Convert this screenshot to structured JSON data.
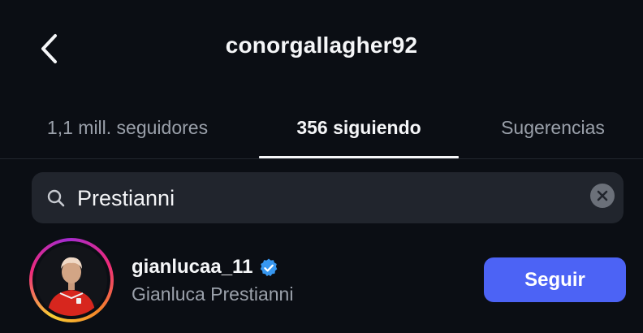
{
  "header": {
    "back_icon": "chevron-left-icon",
    "title": "conorgallagher92"
  },
  "tabs": [
    {
      "label": "1,1 mill. seguidores",
      "active": false
    },
    {
      "label": "356 siguiendo",
      "active": true
    },
    {
      "label": "Sugerencias",
      "active": false
    }
  ],
  "search": {
    "icon": "search-icon",
    "value": "Prestianni",
    "clear_icon": "clear-icon"
  },
  "results": [
    {
      "username": "gianlucaa_11",
      "verified": true,
      "full_name": "Gianluca Prestianni",
      "has_story_ring": true,
      "follow_label": "Seguir"
    }
  ],
  "colors": {
    "background": "#0b0e14",
    "search_bg": "#21252d",
    "follow_button": "#4c63f5",
    "verified_badge": "#3797f0",
    "muted_text": "#9aa0aa"
  }
}
